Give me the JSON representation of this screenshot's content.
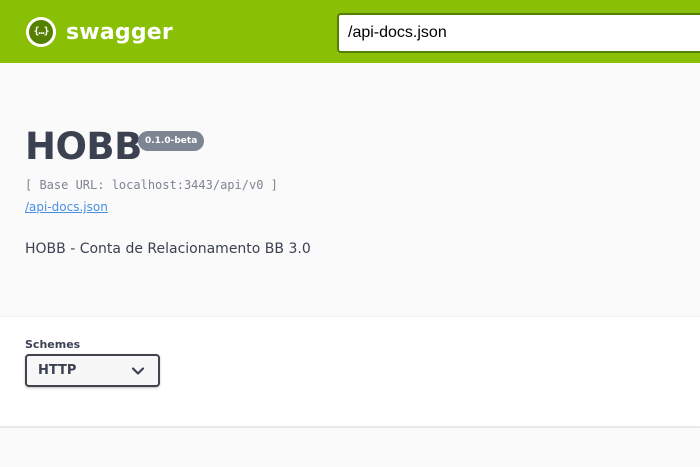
{
  "topbar": {
    "logo_glyph": "{…}",
    "logo_text": "swagger",
    "url_value": "/api-docs.json",
    "colors": {
      "bar": "#89bf04",
      "accent": "#547f00"
    }
  },
  "info": {
    "title": "HOBB",
    "version": "0.1.0-beta",
    "base_url": "[ Base URL: localhost:3443/api/v0 ]",
    "docs_link": "/api-docs.json",
    "description": "HOBB - Conta de Relacionamento BB 3.0"
  },
  "schemes": {
    "label": "Schemes",
    "selected": "HTTP",
    "icon": "chevron-down-icon"
  }
}
